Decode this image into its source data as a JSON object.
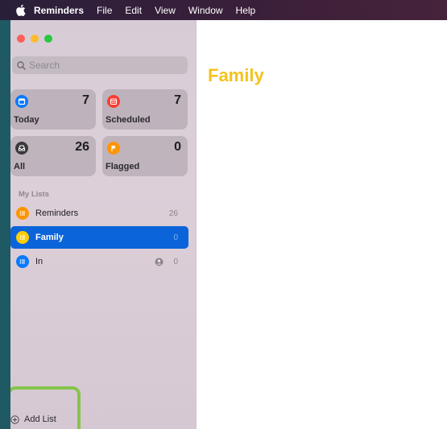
{
  "menubar": {
    "app_name": "Reminders",
    "items": [
      "File",
      "Edit",
      "View",
      "Window",
      "Help"
    ]
  },
  "search": {
    "placeholder": "Search"
  },
  "smart_lists": [
    {
      "label": "Today",
      "count": "7",
      "color": "#0a7aff",
      "icon": "calendar-icon"
    },
    {
      "label": "Scheduled",
      "count": "7",
      "color": "#ff3b30",
      "icon": "calendar-grid-icon"
    },
    {
      "label": "All",
      "count": "26",
      "color": "#3a3a3c",
      "icon": "tray-icon"
    },
    {
      "label": "Flagged",
      "count": "0",
      "color": "#ff9500",
      "icon": "flag-icon"
    }
  ],
  "my_lists": {
    "title": "My Lists",
    "items": [
      {
        "name": "Reminders",
        "count": "26",
        "color": "#ff9500",
        "selected": false
      },
      {
        "name": "Family",
        "count": "0",
        "color": "#ffcc00",
        "selected": true
      },
      {
        "name": "In",
        "count": "0",
        "color": "#0a7aff",
        "selected": false,
        "shared": true
      }
    ]
  },
  "add_list_label": "Add List",
  "main": {
    "title": "Family",
    "title_color": "#f4c21d"
  },
  "highlight_color": "#86c44a"
}
